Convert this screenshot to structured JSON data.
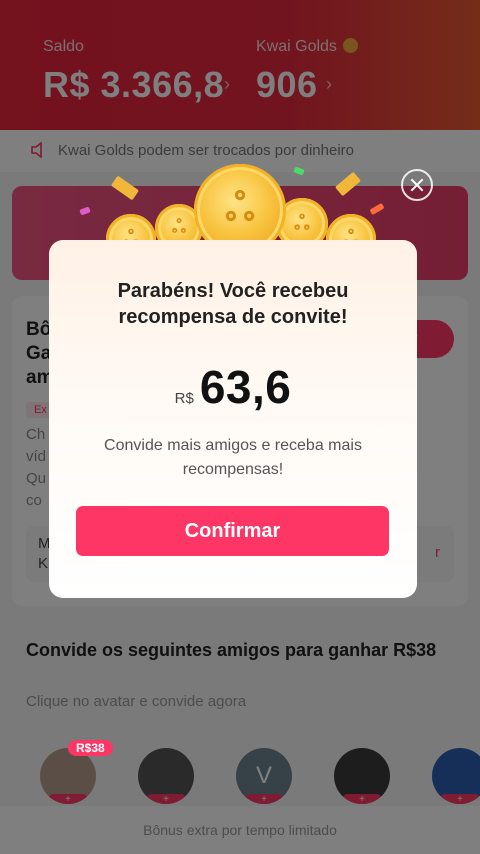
{
  "header": {
    "balance_label": "Saldo",
    "balance_value": "R$ 3.366,8",
    "golds_label": "Kwai Golds",
    "golds_value": "906"
  },
  "notice": {
    "text": "Kwai Golds podem ser trocados por dinheiro"
  },
  "task_card": {
    "title": "Bô\nGa\nam",
    "button_label": "ar",
    "tag": "Ex",
    "description": "Ch\nvíd\nQu\nco",
    "sub_left": "M\nK",
    "sub_right": "r"
  },
  "invite_section": {
    "title": "Convide os seguintes amigos para ganhar R$38",
    "subtitle": "Clique no avatar e convide agora",
    "badge": "R$38",
    "avatar_initial": "V"
  },
  "bottom_bar": {
    "text": "Bônus extra por tempo limitado"
  },
  "modal": {
    "title": "Parabéns! Você recebeu\nrecompensa de convite!",
    "currency": "R$",
    "amount": "63,6",
    "message": "Convide mais amigos e receba mais\nrecompensas!",
    "confirm_label": "Confirmar"
  },
  "colors": {
    "accent": "#fe3666",
    "header_red": "#e3283f",
    "gold": "#f8c440"
  },
  "icons": [
    "gold-coin-icon",
    "speaker-icon",
    "close-icon",
    "chevron-right-icon"
  ]
}
